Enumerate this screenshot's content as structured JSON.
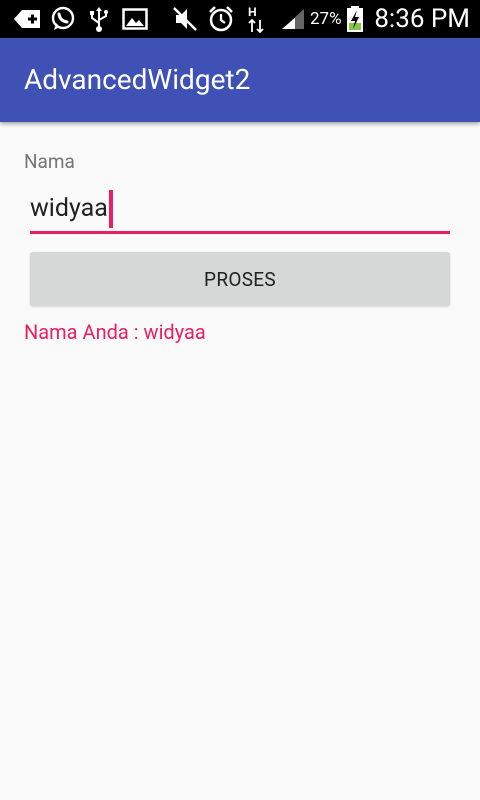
{
  "status_bar": {
    "battery_percent": "27%",
    "time": "8:36 PM",
    "icons": [
      "add-icon",
      "whatsapp-icon",
      "usb-icon",
      "image-icon",
      "mute-icon",
      "alarm-icon",
      "data-transfer-icon",
      "signal-icon",
      "battery-charging-icon"
    ]
  },
  "app_bar": {
    "title": "AdvancedWidget2",
    "color": "#3f51b5"
  },
  "form": {
    "label": "Nama",
    "input_value": "widyaa",
    "accent_color": "#e91e63",
    "button_label": "PROSES",
    "result_text": "Nama Anda : widyaa"
  }
}
